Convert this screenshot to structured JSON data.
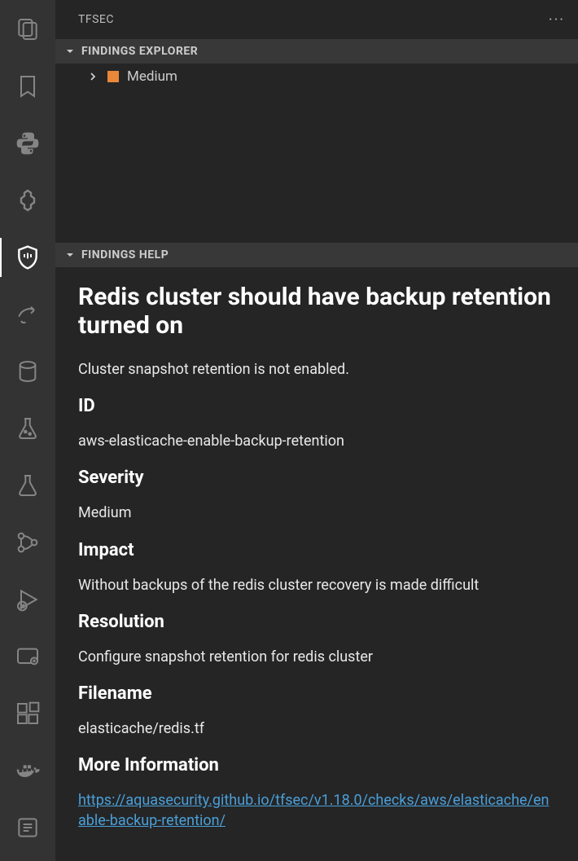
{
  "sidebar": {
    "title": "TFSEC"
  },
  "sections": {
    "explorer": {
      "title": "FINDINGS EXPLORER",
      "items": [
        {
          "label": "Medium",
          "severity": "medium"
        }
      ]
    },
    "help": {
      "title": "FINDINGS HELP"
    }
  },
  "finding": {
    "heading": "Redis cluster should have backup retention turned on",
    "summary": "Cluster snapshot retention is not enabled.",
    "id_label": "ID",
    "id_value": "aws-elasticache-enable-backup-retention",
    "severity_label": "Severity",
    "severity_value": "Medium",
    "impact_label": "Impact",
    "impact_value": "Without backups of the redis cluster recovery is made difficult",
    "resolution_label": "Resolution",
    "resolution_value": "Configure snapshot retention for redis cluster",
    "filename_label": "Filename",
    "filename_value": "elasticache/redis.tf",
    "more_info_label": "More Information",
    "more_info_url": "https://aquasecurity.github.io/tfsec/v1.18.0/checks/aws/elasticache/enable-backup-retention/"
  }
}
